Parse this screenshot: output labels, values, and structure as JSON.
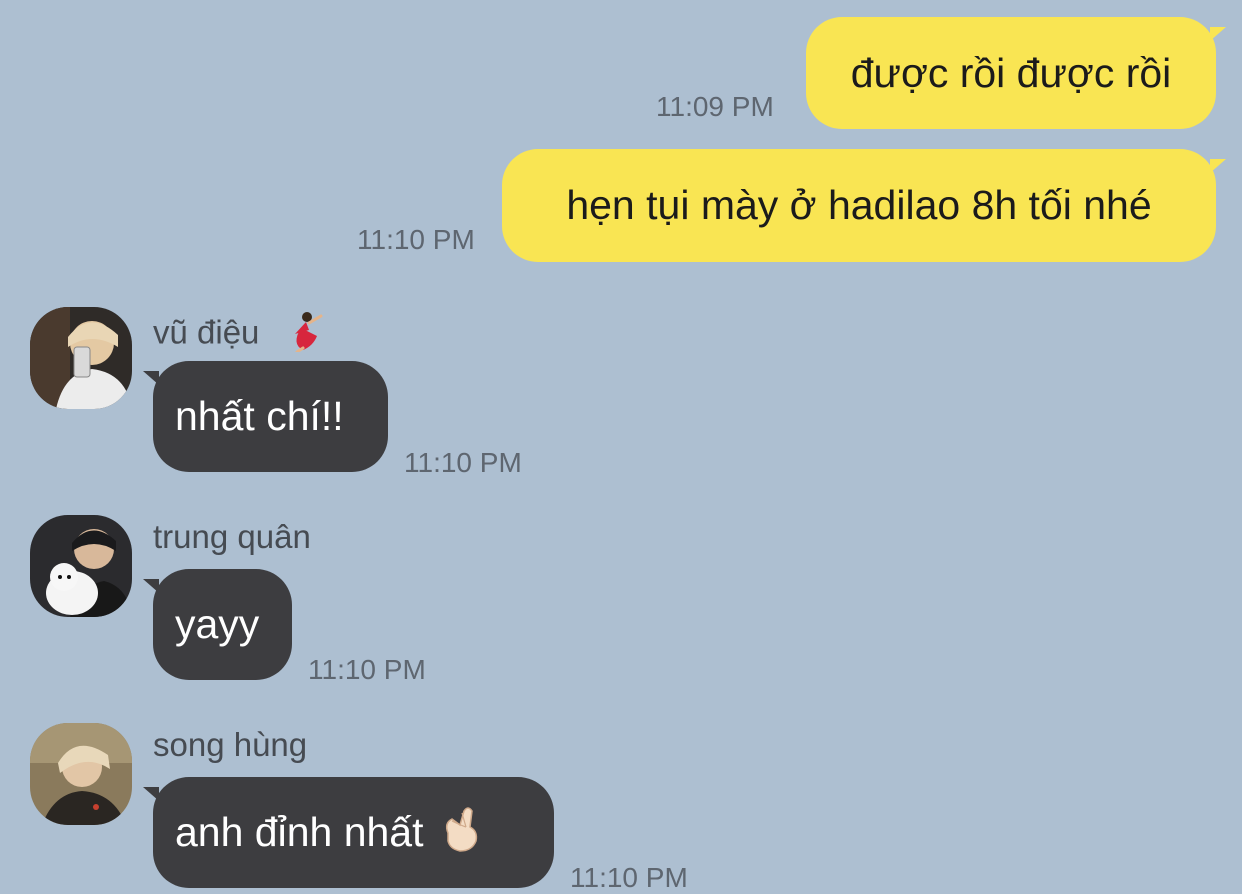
{
  "conversation": {
    "outgoing": [
      {
        "text": "được rồi được rồi",
        "time": "11:09 PM"
      },
      {
        "text": "hẹn tụi mày ở hadilao 8h tối nhé",
        "time": "11:10 PM"
      }
    ],
    "incoming": [
      {
        "sender": "vũ điệu",
        "sender_emoji": "dancer-emoji",
        "avatar": "avatar-photo-selfie-with-phone",
        "text": "nhất chí!!",
        "time": "11:10 PM"
      },
      {
        "sender": "trung quân",
        "avatar": "avatar-photo-with-white-dog",
        "text": "yayy",
        "time": "11:10 PM"
      },
      {
        "sender": "song hùng",
        "avatar": "avatar-photo-blond-hair",
        "text": "anh đỉnh nhất",
        "text_emoji": "finger-heart-emoji",
        "time": "11:10 PM"
      }
    ]
  },
  "colors": {
    "background": "#adbfd1",
    "outgoing_bubble": "#f9e553",
    "incoming_bubble": "#3d3d40",
    "timestamp": "#5e6670"
  }
}
